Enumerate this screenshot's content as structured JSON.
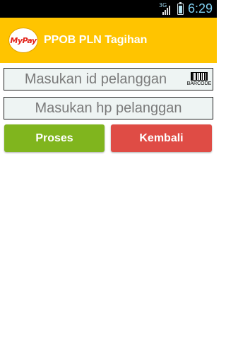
{
  "status_bar": {
    "network": "3G",
    "time": "6:29",
    "signal_level": 4,
    "signal_max": 4,
    "battery_level": 0.85
  },
  "action_bar": {
    "logo_text": "MyPay",
    "title": "PPOB PLN Tagihan",
    "background": "#ffc400"
  },
  "form": {
    "id_placeholder": "Masukan id pelanggan",
    "hp_placeholder": "Masukan hp pelanggan",
    "barcode_label": "BARCODE",
    "proses_label": "Proses",
    "kembali_label": "Kembali",
    "proses_color": "#80b51e",
    "kembali_color": "#df4c45"
  }
}
